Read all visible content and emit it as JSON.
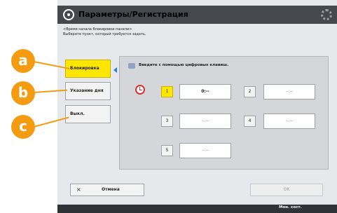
{
  "window": {
    "title": "Параметры/Регистрация"
  },
  "instruction": {
    "line1": "<Время начала блокировки панели>",
    "line2": "Выберите пункт, который требуется задать."
  },
  "options": [
    {
      "label": "Блокировка",
      "selected": true
    },
    {
      "label": "Указание дня",
      "selected": false
    },
    {
      "label": "Выкл.",
      "selected": false
    }
  ],
  "panel": {
    "hint": "Введите с помощью цифровых клавиш.",
    "slots": [
      {
        "number": "1",
        "value": "0:--",
        "selected": true
      },
      {
        "number": "2",
        "value": "--:--",
        "selected": false
      },
      {
        "number": "3",
        "value": "--:--",
        "selected": false
      },
      {
        "number": "4",
        "value": "--:--",
        "selected": false
      },
      {
        "number": "5",
        "value": "--:--",
        "selected": false
      }
    ]
  },
  "callouts": [
    "a",
    "b",
    "c"
  ],
  "footer": {
    "cancel_icon": "×",
    "cancel_label": "Отмена",
    "ok_label": "ОК"
  },
  "statusbar": {
    "text": "Мон. сост."
  },
  "colors": {
    "accent": "#ffe600",
    "callout": "#f39c12",
    "titlebar": "#45484d"
  }
}
